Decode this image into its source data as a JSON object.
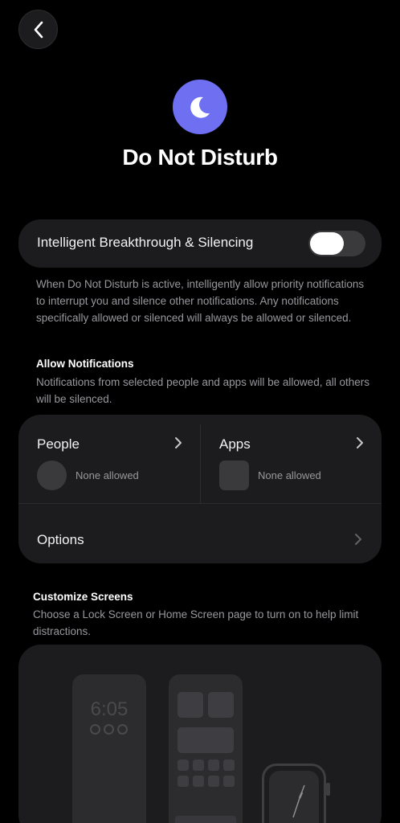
{
  "header": {
    "back_icon": "chevron-left-icon",
    "feature_icon": "moon-icon",
    "feature_icon_color": "#6e6ff1",
    "title": "Do Not Disturb"
  },
  "breakthrough": {
    "label": "Intelligent Breakthrough & Silencing",
    "toggle_on": false,
    "description": "When Do Not Disturb is active, intelligently allow priority notifications to interrupt you and silence other notifications. Any notifications specifically allowed or silenced will always be allowed or silenced."
  },
  "allow_notifications": {
    "heading": "Allow Notifications",
    "description": "Notifications from selected people and apps will be allowed, all others will be silenced.",
    "people": {
      "label": "People",
      "status": "None allowed"
    },
    "apps": {
      "label": "Apps",
      "status": "None allowed"
    },
    "options_label": "Options"
  },
  "customize_screens": {
    "heading": "Customize Screens",
    "description": "Choose a Lock Screen or Home Screen page to turn on to help limit distractions.",
    "lock_screen_time": "6:05"
  }
}
